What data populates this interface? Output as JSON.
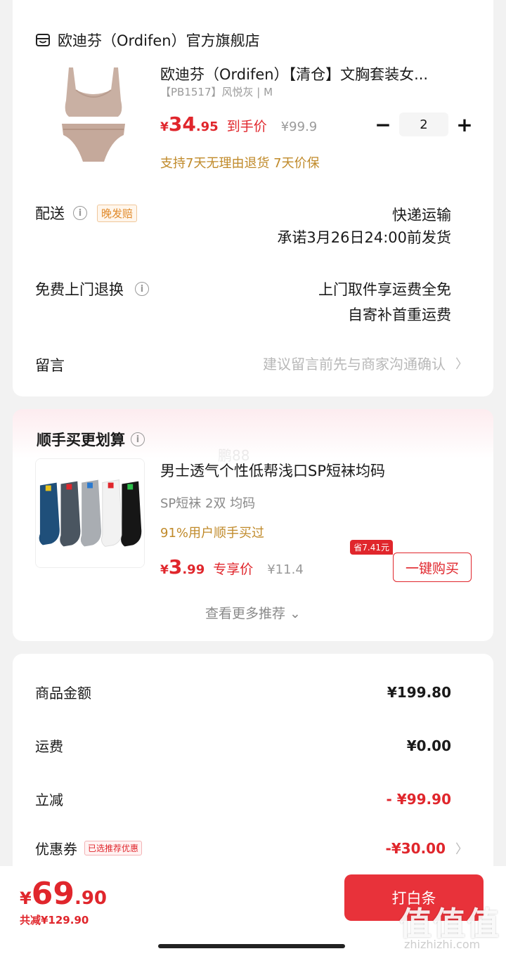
{
  "store": {
    "name": "欧迪芬（Ordifen）官方旗舰店",
    "icon": "store-icon"
  },
  "product": {
    "title": "欧迪芬（Ordifen）【清仓】文胸套装女...",
    "spec": "【PB1517】风悦灰 | M",
    "price_yen": "¥",
    "price_int": "34",
    "price_dec": ".95",
    "price_tag": "到手价",
    "orig_price": "¥99.9",
    "quantity": "2",
    "minus": "−",
    "plus": "+",
    "guarantee": "支持7天无理由退货  7天价保"
  },
  "delivery": {
    "label": "配送",
    "badge": "晚发赔",
    "method": "快递运输",
    "promise": "承诺3月26日24:00前发货"
  },
  "return_service": {
    "label": "免费上门退换",
    "line1": "上门取件享运费全免",
    "line2": "自寄补首重运费"
  },
  "note": {
    "label": "留言",
    "placeholder": "建议留言前先与商家沟通确认"
  },
  "addon": {
    "section_title": "顺手买更划算",
    "title": "男士透气个性低帮浅口SP短袜均码",
    "spec": "SP短袜 2双    均码",
    "buyers": "91%用户顺手买过",
    "price_yen": "¥",
    "price_int": "3",
    "price_dec": ".99",
    "price_tag": "专享价",
    "orig_price": "¥11.4",
    "save_badge": "省7.41元",
    "buy_button": "一键购买",
    "more": "查看更多推荐 ⌄"
  },
  "summary": {
    "goods_label": "商品金额",
    "goods_value": "¥199.80",
    "shipping_label": "运费",
    "shipping_value": "¥0.00",
    "discount_label": "立减",
    "discount_value": "- ¥99.90",
    "coupon_label": "优惠券",
    "coupon_badge": "已选推荐优惠",
    "coupon_value": "-¥30.00"
  },
  "footer": {
    "total_yen": "¥",
    "total_int": "69",
    "total_dec": ".90",
    "saved": "共减¥129.90",
    "pay_button": "打白条"
  },
  "watermark": {
    "logo": "值值值",
    "url": "zhizhizhi.com",
    "mid": "鹏88"
  },
  "colors": {
    "accent": "#e0262c",
    "gold": "#c08a2a",
    "bg": "#f2f2f2"
  }
}
